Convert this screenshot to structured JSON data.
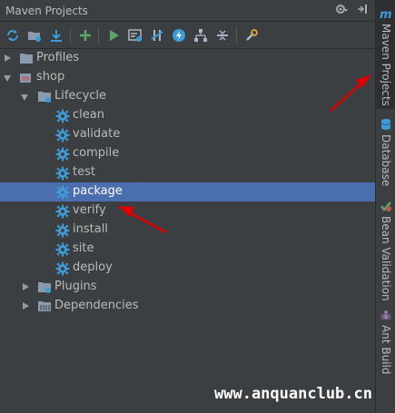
{
  "window": {
    "title": "Maven Projects"
  },
  "toolbar": {
    "buttons": [
      "reimport-icon",
      "generate-sources-icon",
      "download-icon",
      "add-icon",
      "run-icon",
      "execute-goal-icon",
      "toggle-offline-icon",
      "lightning-icon",
      "dependency-tree-icon",
      "collapse-all-icon",
      "settings-icon"
    ]
  },
  "tree": {
    "profiles": "Profiles",
    "project": "shop",
    "lifecycle": "Lifecycle",
    "goals": [
      "clean",
      "validate",
      "compile",
      "test",
      "package",
      "verify",
      "install",
      "site",
      "deploy"
    ],
    "selected_goal": "package",
    "plugins": "Plugins",
    "dependencies": "Dependencies"
  },
  "sidebar": {
    "tabs": [
      {
        "label": "Maven Projects",
        "icon": "maven-m-icon",
        "active": true
      },
      {
        "label": "Database",
        "icon": "database-icon",
        "active": false
      },
      {
        "label": "Bean Validation",
        "icon": "bean-validation-icon",
        "active": false
      },
      {
        "label": "Ant Build",
        "icon": "ant-icon",
        "active": false
      }
    ]
  },
  "watermark": "www.anquanclub.cn",
  "colors": {
    "background": "#3c3f41",
    "selection": "#4b6eaf",
    "annotation_arrow": "#e00000",
    "gear": "#3d9bd5"
  }
}
